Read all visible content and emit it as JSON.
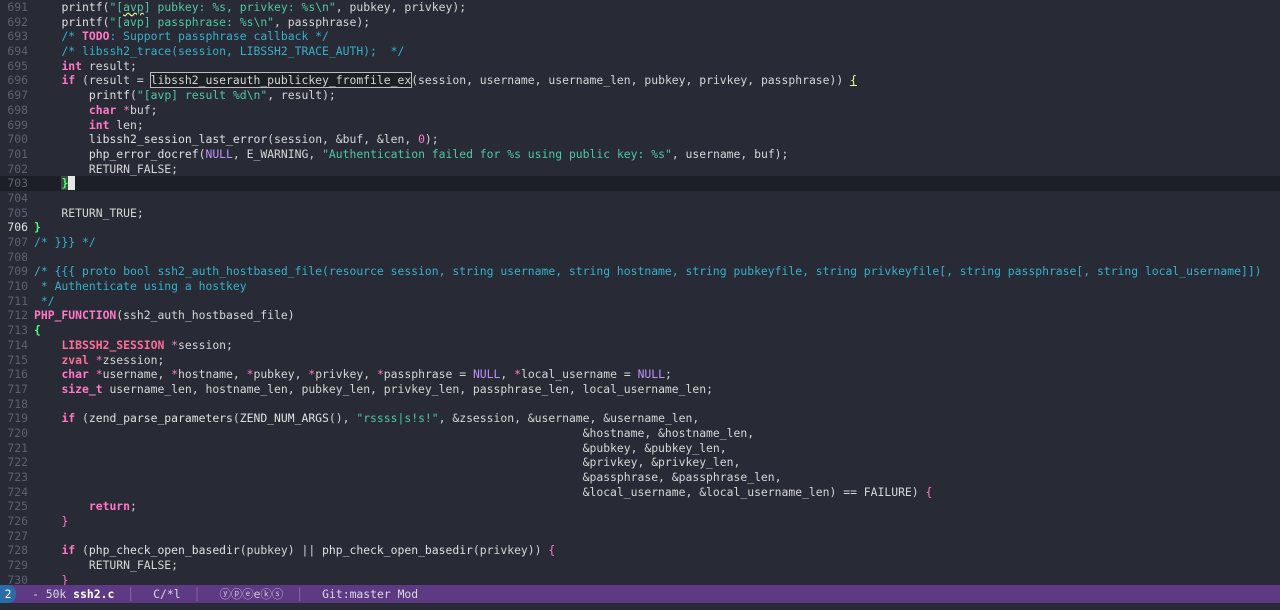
{
  "editor": {
    "cursor_line": 703,
    "lines": [
      {
        "n": "691"
      },
      {
        "n": "692"
      },
      {
        "n": "693"
      },
      {
        "n": "694"
      },
      {
        "n": "695"
      },
      {
        "n": "696"
      },
      {
        "n": "697"
      },
      {
        "n": "698"
      },
      {
        "n": "699"
      },
      {
        "n": "700"
      },
      {
        "n": "701"
      },
      {
        "n": "702"
      },
      {
        "n": "703"
      },
      {
        "n": "704"
      },
      {
        "n": "705"
      },
      {
        "n": "706"
      },
      {
        "n": "707"
      },
      {
        "n": "708"
      },
      {
        "n": "709"
      },
      {
        "n": "710"
      },
      {
        "n": "711"
      },
      {
        "n": "712"
      },
      {
        "n": "713"
      },
      {
        "n": "714"
      },
      {
        "n": "715"
      },
      {
        "n": "716"
      },
      {
        "n": "717"
      },
      {
        "n": "718"
      },
      {
        "n": "719"
      },
      {
        "n": "720"
      },
      {
        "n": "721"
      },
      {
        "n": "722"
      },
      {
        "n": "723"
      },
      {
        "n": "724"
      },
      {
        "n": "725"
      },
      {
        "n": "726"
      },
      {
        "n": "727"
      },
      {
        "n": "728"
      },
      {
        "n": "729"
      },
      {
        "n": "730"
      }
    ]
  },
  "modeline": {
    "window_number": "2",
    "modified_marker": "-",
    "size": "50k",
    "buffer_name": "ssh2.c",
    "major_mode": "C/*l",
    "minor_modes": "ⓨⓟⓔeⓚⓢ",
    "vcs": "Git:master",
    "state": "Mod"
  },
  "colors": {
    "background": "#282a36",
    "current_line": "#1d1f27",
    "modeline": "#5e3a84",
    "keyword": "#ff79c6",
    "string": "#50c8a0",
    "comment": "#35b2c8"
  }
}
